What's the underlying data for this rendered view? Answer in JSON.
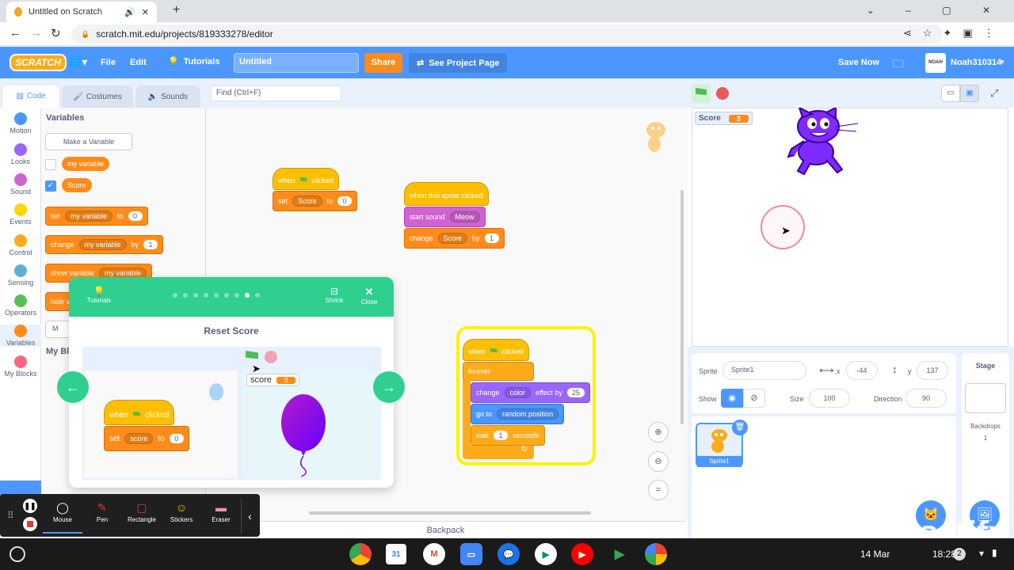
{
  "browser": {
    "tab_title": "Untitled on Scratch",
    "url": "scratch.mit.edu/projects/819333278/editor"
  },
  "menu": {
    "logo": "SCRATCH",
    "file": "File",
    "edit": "Edit",
    "tutorials": "Tutorials",
    "project_title": "Untitled",
    "share": "Share",
    "see_project": "See Project Page",
    "save_now": "Save Now",
    "avatar": "NOAH",
    "username": "Noah310314"
  },
  "tabs": {
    "code": "Code",
    "costumes": "Costumes",
    "sounds": "Sounds"
  },
  "find_placeholder": "Find (Ctrl+F)",
  "categories": [
    {
      "label": "Motion",
      "color": "#4c97ff"
    },
    {
      "label": "Looks",
      "color": "#9966ff"
    },
    {
      "label": "Sound",
      "color": "#cf63cf"
    },
    {
      "label": "Events",
      "color": "#ffd500"
    },
    {
      "label": "Control",
      "color": "#ffab19"
    },
    {
      "label": "Sensing",
      "color": "#5cb1d6"
    },
    {
      "label": "Operators",
      "color": "#59c059"
    },
    {
      "label": "Variables",
      "color": "#ff8c1a"
    },
    {
      "label": "My Blocks",
      "color": "#ff6680"
    }
  ],
  "palette": {
    "heading": "Variables",
    "make_variable": "Make a Variable",
    "var1": "my variable",
    "var2": "Score",
    "set": "set",
    "to": "to",
    "change": "change",
    "by": "by",
    "show_variable": "show variable",
    "hide_v": "hide v",
    "m": "M",
    "my_blocks": "My Blo",
    "zero": "0",
    "one": "1"
  },
  "script1": {
    "when": "when",
    "clicked": "clicked",
    "set": "set",
    "var": "Score",
    "to": "to",
    "val": "0"
  },
  "script2": {
    "hat": "when this sprite clicked",
    "start_sound": "start sound",
    "sound": "Meow",
    "change": "change",
    "var": "Score",
    "by": "by",
    "val": "1"
  },
  "script3": {
    "when": "when",
    "clicked": "clicked",
    "forever": "forever",
    "change": "change",
    "effect": "color",
    "effect_by": "effect by",
    "effect_val": "25",
    "go_to": "go to",
    "position": "random position",
    "wait": "wait",
    "wait_val": "1",
    "seconds": "seconds"
  },
  "tutorial": {
    "label": "Tutorials",
    "shrink": "Shrink",
    "close": "Close",
    "title": "Reset Score",
    "when": "when",
    "clicked": "clicked",
    "set": "set",
    "var": "score",
    "to": "to",
    "val": "0",
    "monitor_label": "score",
    "monitor_val": "0"
  },
  "stage": {
    "monitor_label": "Score",
    "monitor_value": "3"
  },
  "sprite_info": {
    "sprite_label": "Sprite",
    "sprite_name": "Sprite1",
    "x_label": "x",
    "x": "-44",
    "y_label": "y",
    "y": "137",
    "show_label": "Show",
    "size_label": "Size",
    "size": "100",
    "direction_label": "Direction",
    "direction": "90",
    "thumb_name": "Sprite1"
  },
  "stage_panel": {
    "title": "Stage",
    "backdrops_label": "Backdrops",
    "backdrops_count": "1"
  },
  "backpack": "Backpack",
  "screencastify_tools": [
    "Mouse",
    "Pen",
    "Rectangle",
    "Stickers",
    "Eraser"
  ],
  "watermark": {
    "line1": "MADE WITH",
    "line2": "Screencastify"
  },
  "taskbar": {
    "date": "14 Mar",
    "time": "18:28",
    "notif": "2"
  }
}
